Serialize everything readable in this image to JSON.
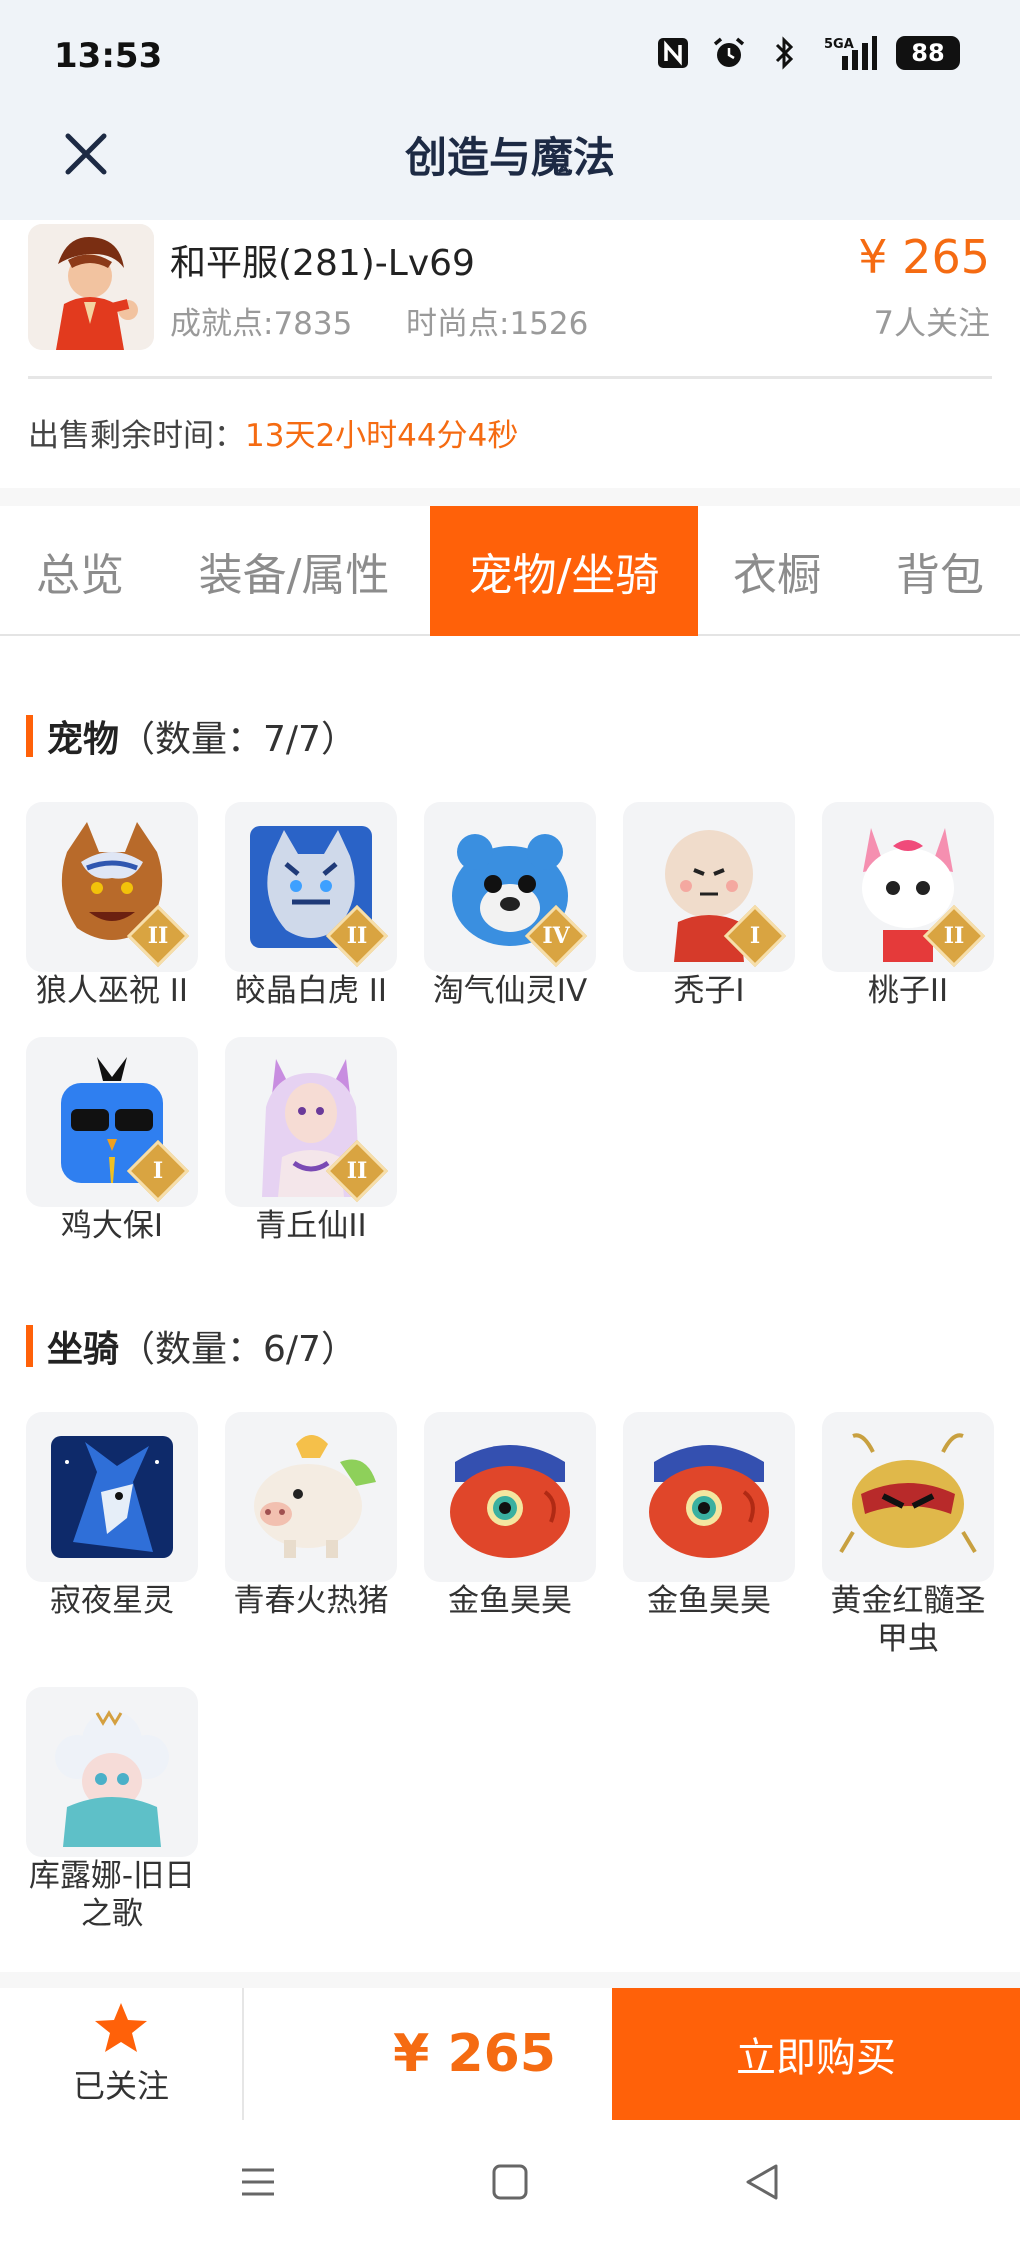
{
  "status": {
    "time": "13:53",
    "battery": "88",
    "network": "5GA"
  },
  "nav": {
    "title": "创造与魔法"
  },
  "account": {
    "role": "和平服(281)-Lv69",
    "achievement": "成就点:7835",
    "fashion": "时尚点:1526",
    "price": "¥ 265",
    "followers": "7人关注",
    "remain_label": "出售剩余时间：",
    "remain_value": "13天2小时44分4秒"
  },
  "tabs": [
    "总览",
    "装备/属性",
    "宠物/坐骑",
    "衣橱",
    "背包"
  ],
  "active_tab": "宠物/坐骑",
  "pets": {
    "title": "宠物",
    "count": "（数量：7/7）",
    "items": [
      {
        "name": "狼人巫祝 II",
        "badge": "II"
      },
      {
        "name": "皎晶白虎 II",
        "badge": "II"
      },
      {
        "name": "淘气仙灵IV",
        "badge": "IV"
      },
      {
        "name": "秃子I",
        "badge": "I"
      },
      {
        "name": "桃子II",
        "badge": "II"
      },
      {
        "name": "鸡大保I",
        "badge": "I"
      },
      {
        "name": "青丘仙II",
        "badge": "II"
      }
    ]
  },
  "mounts": {
    "title": "坐骑",
    "count": "（数量：6/7）",
    "items": [
      {
        "name": "寂夜星灵"
      },
      {
        "name": "青春火热猪"
      },
      {
        "name": "金鱼昊昊"
      },
      {
        "name": "金鱼昊昊"
      },
      {
        "name": "黄金红髓圣甲虫"
      },
      {
        "name": "库露娜-旧日之歌"
      }
    ]
  },
  "bottom": {
    "follow_label": "已关注",
    "price": "¥ 265",
    "buy_label": "立即购买"
  },
  "colors": {
    "accent": "#ff6109",
    "price": "#f56b12",
    "header_bg": "#eff3f8"
  }
}
